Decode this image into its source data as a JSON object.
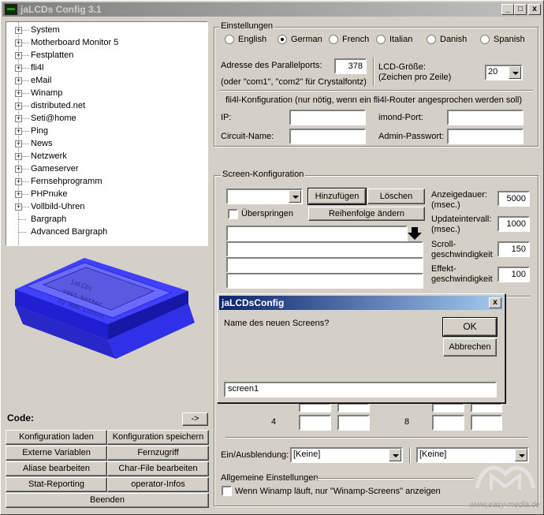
{
  "window": {
    "title": "jaLCDs Config 3.1",
    "minimize": "_",
    "maximize": "□",
    "close": "x"
  },
  "tree": {
    "items": [
      {
        "label": "System",
        "expandable": true
      },
      {
        "label": "Motherboard Monitor 5",
        "expandable": true
      },
      {
        "label": "Festplatten",
        "expandable": true
      },
      {
        "label": "fli4l",
        "expandable": true
      },
      {
        "label": "eMail",
        "expandable": true
      },
      {
        "label": "Winamp",
        "expandable": true
      },
      {
        "label": "distributed.net",
        "expandable": true
      },
      {
        "label": "Seti@home",
        "expandable": true
      },
      {
        "label": "Ping",
        "expandable": true
      },
      {
        "label": "News",
        "expandable": true
      },
      {
        "label": "Netzwerk",
        "expandable": true
      },
      {
        "label": "Gameserver",
        "expandable": true
      },
      {
        "label": "Fernsehprogramm",
        "expandable": true
      },
      {
        "label": "PHPnuke",
        "expandable": true
      },
      {
        "label": "Vollbild-Uhren",
        "expandable": true
      },
      {
        "label": "Bargraph",
        "expandable": false
      },
      {
        "label": "Advanced Bargraph",
        "expandable": false
      }
    ]
  },
  "lcd_text": {
    "line1": "jaLCDs",
    "line2": "rest bother",
    "line3": "by Rob Lanson"
  },
  "code": {
    "label": "Code:",
    "button": "->"
  },
  "left_buttons": [
    [
      "Konfiguration laden",
      "Konfiguration speichern"
    ],
    [
      "Externe Variablen",
      "Fernzugriff"
    ],
    [
      "Aliase bearbeiten",
      "Char-File bearbeiten"
    ],
    [
      "Stat-Reporting",
      "operator-Infos"
    ]
  ],
  "exit_button": "Beenden",
  "settings": {
    "title": "Einstellungen",
    "languages": [
      {
        "label": "English",
        "selected": false
      },
      {
        "label": "German",
        "selected": true
      },
      {
        "label": "French",
        "selected": false
      },
      {
        "label": "Italian",
        "selected": false
      },
      {
        "label": "Danish",
        "selected": false
      },
      {
        "label": "Spanish",
        "selected": false
      }
    ],
    "parport_label": "Adresse des Parallelports:",
    "parport_value": "378",
    "parport_hint": "(oder \"com1\", \"com2\" für Crystalfontz)",
    "lcd_size_label_1": "LCD-Größe:",
    "lcd_size_label_2": "(Zeichen pro Zeile)",
    "lcd_size_value": "20",
    "fli4l_title": "fli4l-Konfiguration (nur nötig, wenn ein fli4l-Router angesprochen werden soll)",
    "ip_label": "IP:",
    "imond_port_label": "imond-Port:",
    "circuit_label": "Circuit-Name:",
    "admin_pw_label": "Admin-Passwort:"
  },
  "screen_config": {
    "title": "Screen-Konfiguration",
    "add_button": "Hinzufügen",
    "delete_button": "Löschen",
    "skip_label": "Überspringen",
    "reorder_button": "Reihenfolge ändern",
    "display_duration_1": "Anzeigedauer:",
    "display_duration_2": "(msec.)",
    "display_duration_value": "5000",
    "update_interval_1": "Updateintervall:",
    "update_interval_2": "(msec.)",
    "update_interval_value": "1000",
    "scroll_speed_1": "Scroll-",
    "scroll_speed_2": "geschwindigkeit",
    "scroll_speed_value": "150",
    "effect_speed_1": "Effekt-",
    "effect_speed_2": "geschwindigkeit",
    "effect_speed_value": "100",
    "row_4": "4",
    "row_8": "8"
  },
  "fade": {
    "label": "Ein/Ausblendung:",
    "in_value": "[Keine]",
    "out_value": "[Keine]"
  },
  "general": {
    "title": "Allgemeine Einstellungen",
    "winamp_label": "Wenn Winamp läuft, nur \"Winamp-Screens\" anzeigen"
  },
  "dialog": {
    "title": "jaLCDsConfig",
    "close": "x",
    "prompt": "Name des neuen Screens?",
    "ok": "OK",
    "cancel": "Abbrechen",
    "input_value": "screen1"
  },
  "watermark": "www.easy-media.de"
}
